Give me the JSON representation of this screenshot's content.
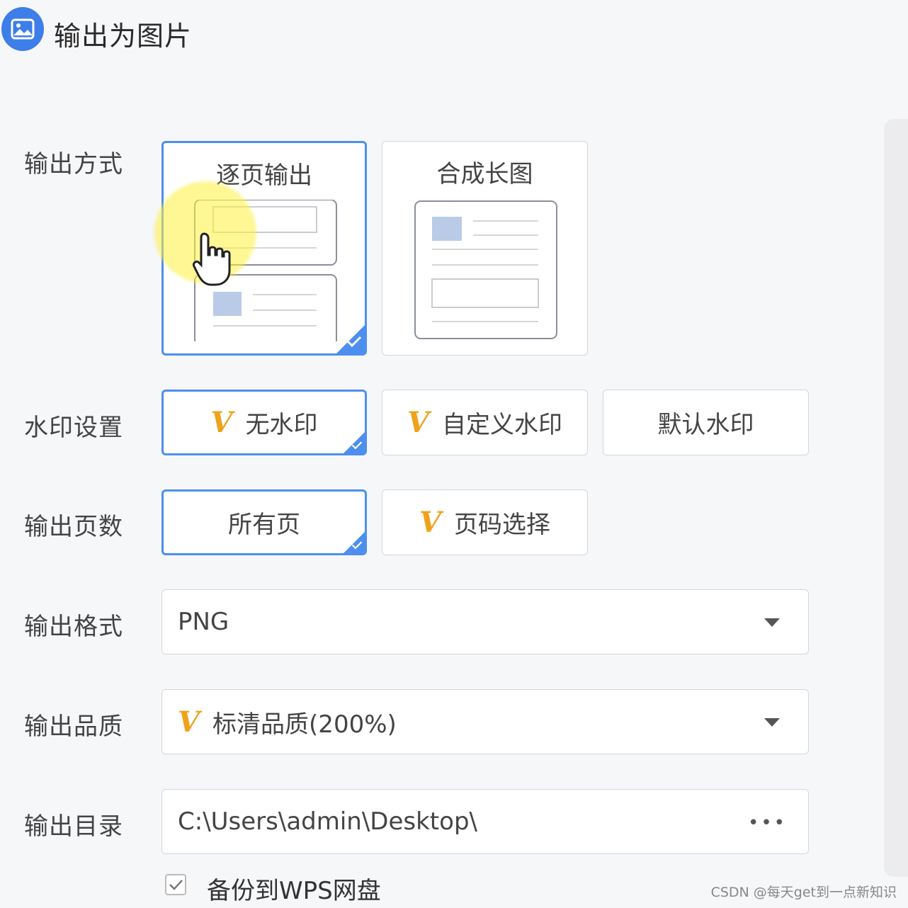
{
  "dialog": {
    "title": "输出为图片",
    "title_icon": "image-icon"
  },
  "output_mode": {
    "label": "输出方式",
    "options": [
      {
        "label": "逐页输出",
        "selected": true
      },
      {
        "label": "合成长图",
        "selected": false
      }
    ]
  },
  "watermark": {
    "label": "水印设置",
    "options": [
      {
        "label": "无水印",
        "vip": "V",
        "selected": true
      },
      {
        "label": "自定义水印",
        "vip": "V",
        "selected": false
      },
      {
        "label": "默认水印",
        "selected": false
      }
    ]
  },
  "pages": {
    "label": "输出页数",
    "options": [
      {
        "label": "所有页",
        "selected": true
      },
      {
        "label": "页码选择",
        "vip": "V",
        "selected": false
      }
    ]
  },
  "format": {
    "label": "输出格式",
    "value": "PNG"
  },
  "quality": {
    "label": "输出品质",
    "vip": "V",
    "value": "标清品质(200%)"
  },
  "directory": {
    "label": "输出目录",
    "value": "C:\\Users\\admin\\Desktop\\",
    "browse": "•••"
  },
  "backup": {
    "label": "备份到WPS网盘",
    "checked": true
  },
  "footer_watermark": "CSDN @每天get到一点新知识",
  "colors": {
    "accent": "#4d8fee",
    "vip": "#f0a21b"
  }
}
